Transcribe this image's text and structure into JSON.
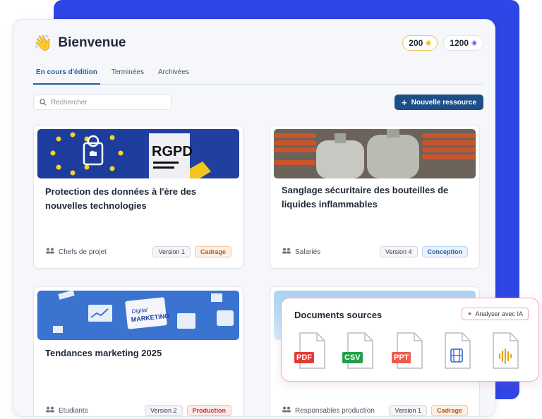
{
  "header": {
    "title": "Bienvenue",
    "wave_icon": "waving-hand-icon"
  },
  "credits": [
    {
      "value": "200",
      "color": "#f5b800"
    },
    {
      "value": "1200",
      "color": "#7a3ff2"
    }
  ],
  "tabs": [
    {
      "label": "En cours d'édition",
      "active": true
    },
    {
      "label": "Terminées",
      "active": false
    },
    {
      "label": "Archivées",
      "active": false
    }
  ],
  "search": {
    "placeholder": "Rechercher"
  },
  "new_button": {
    "label": "Nouvelle ressource"
  },
  "cards": [
    {
      "title": "Protection des données à l'ère des nouvelles technologies",
      "audience": "Chefs de projet",
      "version": "Version 1",
      "stage": "Cadrage",
      "stage_color": "orange",
      "image_text": "RGPD"
    },
    {
      "title": "Sanglage sécuritaire des bouteilles de liquides inflammables",
      "audience": "Salariés",
      "version": "Version 4",
      "stage": "Conception",
      "stage_color": "blue"
    },
    {
      "title": "Tendances marketing 2025",
      "audience": "Etudiants",
      "version": "Version 2",
      "stage": "Production",
      "stage_color": "red",
      "image_text_1": "Digital",
      "image_text_2": "MARKETING"
    },
    {
      "audience": "Responsables production",
      "version": "Version 1",
      "stage": "Cadrage",
      "stage_color": "orange"
    }
  ],
  "documents": {
    "title": "Documents sources",
    "ai_button": "Analyser avec IA",
    "files": [
      {
        "label": "PDF",
        "color": "#e53935"
      },
      {
        "label": "CSV",
        "color": "#22a047"
      },
      {
        "label": "PPT",
        "color": "#ef5a4a"
      },
      {
        "icon": "video-file-icon",
        "color": "#4a74d8"
      },
      {
        "icon": "audio-file-icon",
        "color": "#e5a31c"
      }
    ]
  }
}
